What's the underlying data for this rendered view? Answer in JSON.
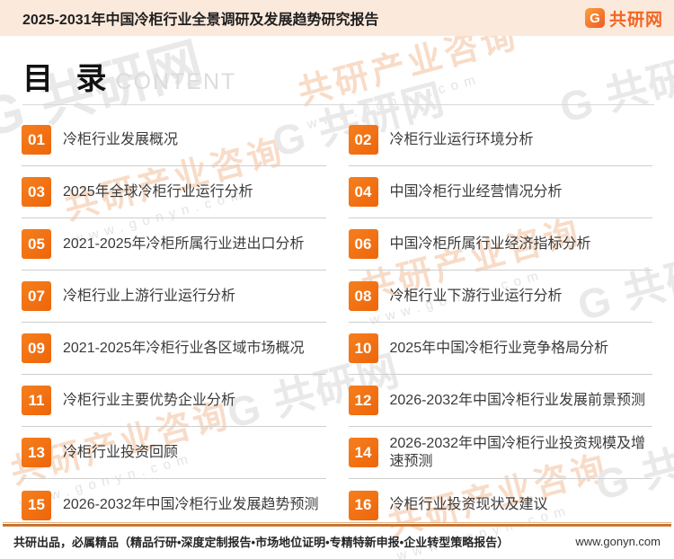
{
  "header": {
    "title": "2025-2031年中国冷柜行业全景调研及发展趋势研究报告",
    "logo_icon": "G",
    "logo_text": "共研网"
  },
  "toc": {
    "title_cn": "目 录",
    "title_en": "CONTENT",
    "items": [
      {
        "num": "01",
        "label": "冷柜行业发展概况"
      },
      {
        "num": "02",
        "label": "冷柜行业运行环境分析"
      },
      {
        "num": "03",
        "label": "2025年全球冷柜行业运行分析"
      },
      {
        "num": "04",
        "label": "中国冷柜行业经营情况分析"
      },
      {
        "num": "05",
        "label": "2021-2025年冷柜所属行业进出口分析"
      },
      {
        "num": "06",
        "label": "中国冷柜所属行业经济指标分析"
      },
      {
        "num": "07",
        "label": "冷柜行业上游行业运行分析"
      },
      {
        "num": "08",
        "label": "冷柜行业下游行业运行分析"
      },
      {
        "num": "09",
        "label": "2021-2025年冷柜行业各区域市场概况"
      },
      {
        "num": "10",
        "label": "2025年中国冷柜行业竞争格局分析"
      },
      {
        "num": "11",
        "label": "冷柜行业主要优势企业分析"
      },
      {
        "num": "12",
        "label": "2026-2032年中国冷柜行业发展前景预测"
      },
      {
        "num": "13",
        "label": "冷柜行业投资回顾"
      },
      {
        "num": "14",
        "label": "2026-2032年中国冷柜行业投资规模及增速预测"
      },
      {
        "num": "15",
        "label": "2026-2032年中国冷柜行业发展趋势预测"
      },
      {
        "num": "16",
        "label": "冷柜行业投资现状及建议"
      }
    ]
  },
  "footer": {
    "left_text": "共研出品，必属精品（精品行研•深度定制报告•市场地位证明•专精特新申报•企业转型策略报告）",
    "right_text": "www.gonyn.com"
  },
  "watermark": {
    "brand": "共研产业咨询",
    "url": "www.gonyn.com",
    "logo": "G 共研网"
  },
  "colors": {
    "accent_orange": "#f26e0e",
    "header_bg": "#fbe9dc",
    "logo_orange": "#f26522,",
    "separator": "#cfcfcf"
  }
}
